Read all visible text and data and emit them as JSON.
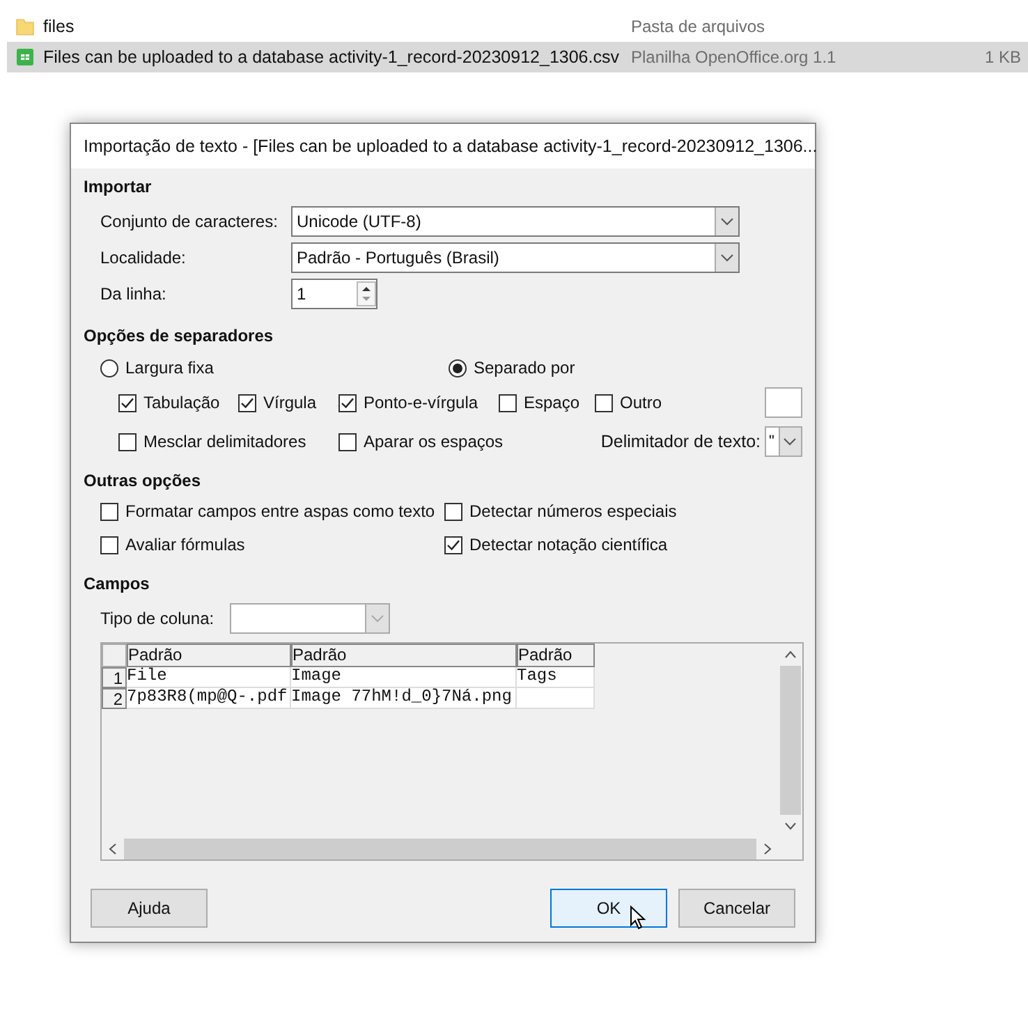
{
  "files": [
    {
      "kind": "folder",
      "name": "files",
      "type": "Pasta de arquivos",
      "selected": false
    },
    {
      "kind": "spreadsheet",
      "name": "Files can be uploaded to a database activity-1_record-20230912_1306.csv",
      "type": "Planilha OpenOffice.org 1.1",
      "size": "1 KB",
      "selected": true
    }
  ],
  "dialog": {
    "title": "Importação de texto - [Files can be uploaded to a database activity-1_record-20230912_1306...",
    "import": {
      "heading": "Importar",
      "charset_label": "Conjunto de caracteres:",
      "charset": "Unicode (UTF-8)",
      "locale_label": "Localidade:",
      "locale": "Padrão - Português (Brasil)",
      "from_row_label": "Da linha:",
      "from_row": "1"
    },
    "separators": {
      "heading": "Opções de separadores",
      "modes": [
        {
          "label": "Largura fixa",
          "selected": false
        },
        {
          "label": "Separado por",
          "selected": true
        }
      ],
      "options": [
        {
          "label": "Tabulação",
          "checked": true
        },
        {
          "label": "Vírgula",
          "checked": true
        },
        {
          "label": "Ponto-e-vírgula",
          "checked": true
        },
        {
          "label": "Espaço",
          "checked": false
        },
        {
          "label": "Outro",
          "checked": false
        }
      ],
      "merge": [
        {
          "label": "Mesclar delimitadores",
          "checked": false
        },
        {
          "label": "Aparar os espaços",
          "checked": false
        }
      ],
      "text_delimiter_label": "Delimitador de texto:",
      "text_delimiter": "\""
    },
    "other": {
      "heading": "Outras opções",
      "options": [
        {
          "label": "Formatar campos entre aspas como texto",
          "checked": false
        },
        {
          "label": "Detectar números especiais",
          "checked": false
        },
        {
          "label": "Avaliar fórmulas",
          "checked": false
        },
        {
          "label": "Detectar notação científica",
          "checked": true
        }
      ]
    },
    "fields": {
      "heading": "Campos",
      "column_type_label": "Tipo de coluna:",
      "columns": [
        "Padrão",
        "Padrão",
        "Padrão"
      ],
      "rows": [
        {
          "number": "1",
          "cells": [
            "File",
            "Image",
            "Tags"
          ]
        },
        {
          "number": "2",
          "cells": [
            "7p83R8(mp@Q-.pdf",
            "Image 77hM!d_0}7Ná.png"
          ]
        }
      ]
    },
    "buttons": {
      "help": "Ajuda",
      "ok": "OK",
      "cancel": "Cancelar"
    }
  }
}
